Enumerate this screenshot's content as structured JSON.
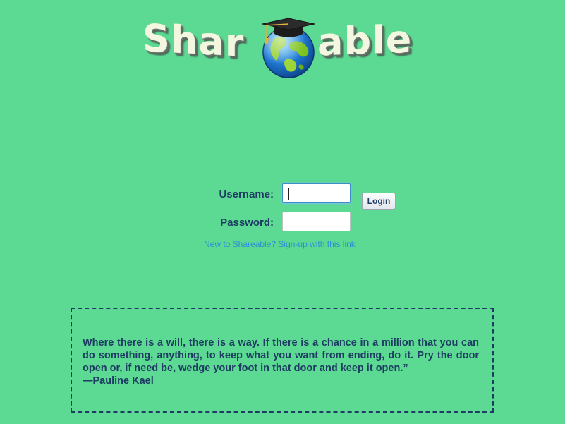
{
  "logo": {
    "text_left": "Shar",
    "text_right": "able"
  },
  "login": {
    "username_label": "Username:",
    "username_value": "",
    "password_label": "Password:",
    "password_value": "",
    "login_button_label": "Login",
    "signup_link_text": "New to Shareable? Sign-up with this link"
  },
  "quote": {
    "text": "Where there is a will, there is a way. If there is a chance in a million that you can do something, anything, to keep what you want from ending, do it. Pry the door open or, if need be, wedge your foot in that door and keep it open.”",
    "author": "—Pauline Kael"
  },
  "colors": {
    "background": "#5cd993",
    "text": "#1d3b63",
    "link": "#2d8fd4",
    "input_focus": "#3b8ec8"
  }
}
